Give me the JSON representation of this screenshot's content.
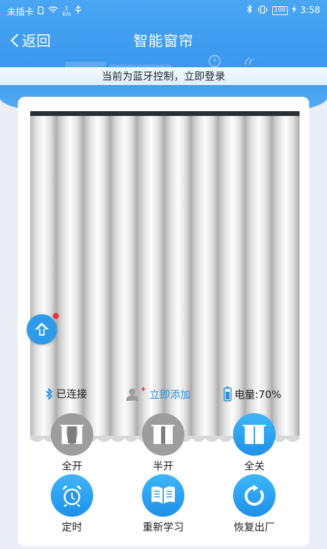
{
  "status_bar": {
    "carrier": "未插卡",
    "net_speed_top": "1",
    "net_speed_bottom": "K/s",
    "battery": "100",
    "time": "3:58"
  },
  "nav": {
    "back_label": "返回",
    "title": "智能窗帘"
  },
  "banner": {
    "text": "当前为蓝牙控制，立即登录"
  },
  "device_info": {
    "connection": "已连接",
    "add_label": "立即添加",
    "battery_label": "电量:70%"
  },
  "controls": [
    {
      "label": "全开",
      "icon": "curtain-open-icon",
      "style": "gray"
    },
    {
      "label": "半开",
      "icon": "curtain-half-icon",
      "style": "gray"
    },
    {
      "label": "全关",
      "icon": "curtain-closed-icon",
      "style": "blue"
    },
    {
      "label": "定时",
      "icon": "alarm-clock-icon",
      "style": "blue"
    },
    {
      "label": "重新学习",
      "icon": "book-icon",
      "style": "blue"
    },
    {
      "label": "恢复出厂",
      "icon": "reset-icon",
      "style": "blue"
    }
  ],
  "colors": {
    "header_blue": "#3a98ee",
    "accent_blue": "#2c8fd8",
    "inactive_gray": "#9d9d9d",
    "notification_red": "#f2343b"
  }
}
